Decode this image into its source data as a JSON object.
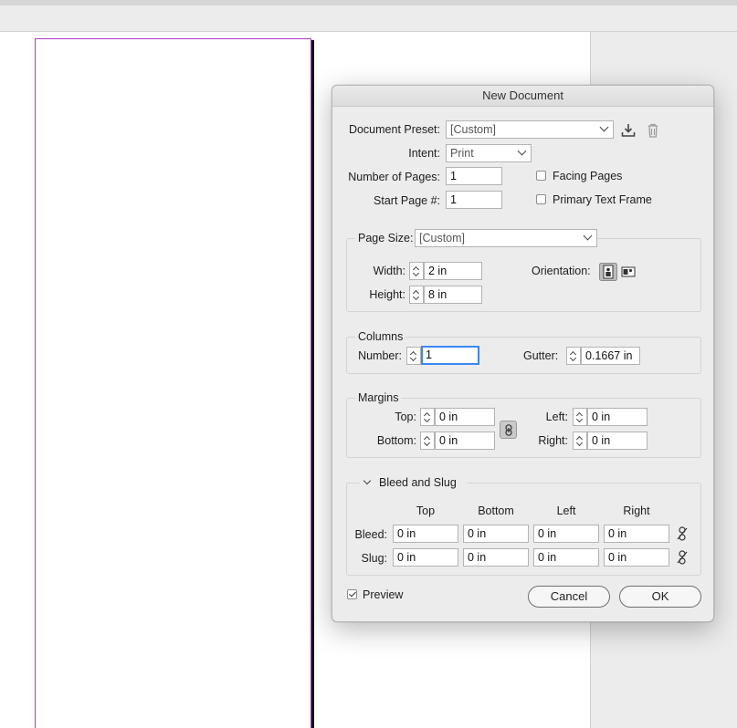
{
  "dialog": {
    "title": "New Document",
    "document_preset": {
      "label": "Document Preset:",
      "value": "[Custom]"
    },
    "intent": {
      "label": "Intent:",
      "value": "Print"
    },
    "pages": {
      "label": "Number of Pages:",
      "value": "1"
    },
    "start_page": {
      "label": "Start Page #:",
      "value": "1"
    },
    "facing_pages": {
      "label": "Facing Pages",
      "checked": false
    },
    "primary_text_frame": {
      "label": "Primary Text Frame",
      "checked": false
    },
    "page_size": {
      "label": "Page Size:",
      "value": "[Custom]",
      "width_label": "Width:",
      "width": "2 in",
      "height_label": "Height:",
      "height": "8 in",
      "orientation_label": "Orientation:"
    },
    "columns": {
      "title": "Columns",
      "number_label": "Number:",
      "number": "1",
      "gutter_label": "Gutter:",
      "gutter": "0.1667 in"
    },
    "margins": {
      "title": "Margins",
      "top_label": "Top:",
      "top": "0 in",
      "bottom_label": "Bottom:",
      "bottom": "0 in",
      "left_label": "Left:",
      "left": "0 in",
      "right_label": "Right:",
      "right": "0 in"
    },
    "bleed_slug": {
      "title": "Bleed and Slug",
      "headers": [
        "Top",
        "Bottom",
        "Left",
        "Right"
      ],
      "bleed_label": "Bleed:",
      "bleed": [
        "0 in",
        "0 in",
        "0 in",
        "0 in"
      ],
      "slug_label": "Slug:",
      "slug": [
        "0 in",
        "0 in",
        "0 in",
        "0 in"
      ]
    },
    "preview": {
      "label": "Preview",
      "checked": true
    },
    "cancel_label": "Cancel",
    "ok_label": "OK"
  },
  "icons": {
    "save_preset": "download-icon",
    "delete_preset": "trash-icon",
    "portrait": "portrait-orientation-icon",
    "landscape": "landscape-orientation-icon",
    "margin_link": "chain-link-icon",
    "bleed_link": "broken-link-icon"
  },
  "colors": {
    "page_margin_guide": "#b03cc8",
    "focus_ring": "#3b86f2"
  }
}
